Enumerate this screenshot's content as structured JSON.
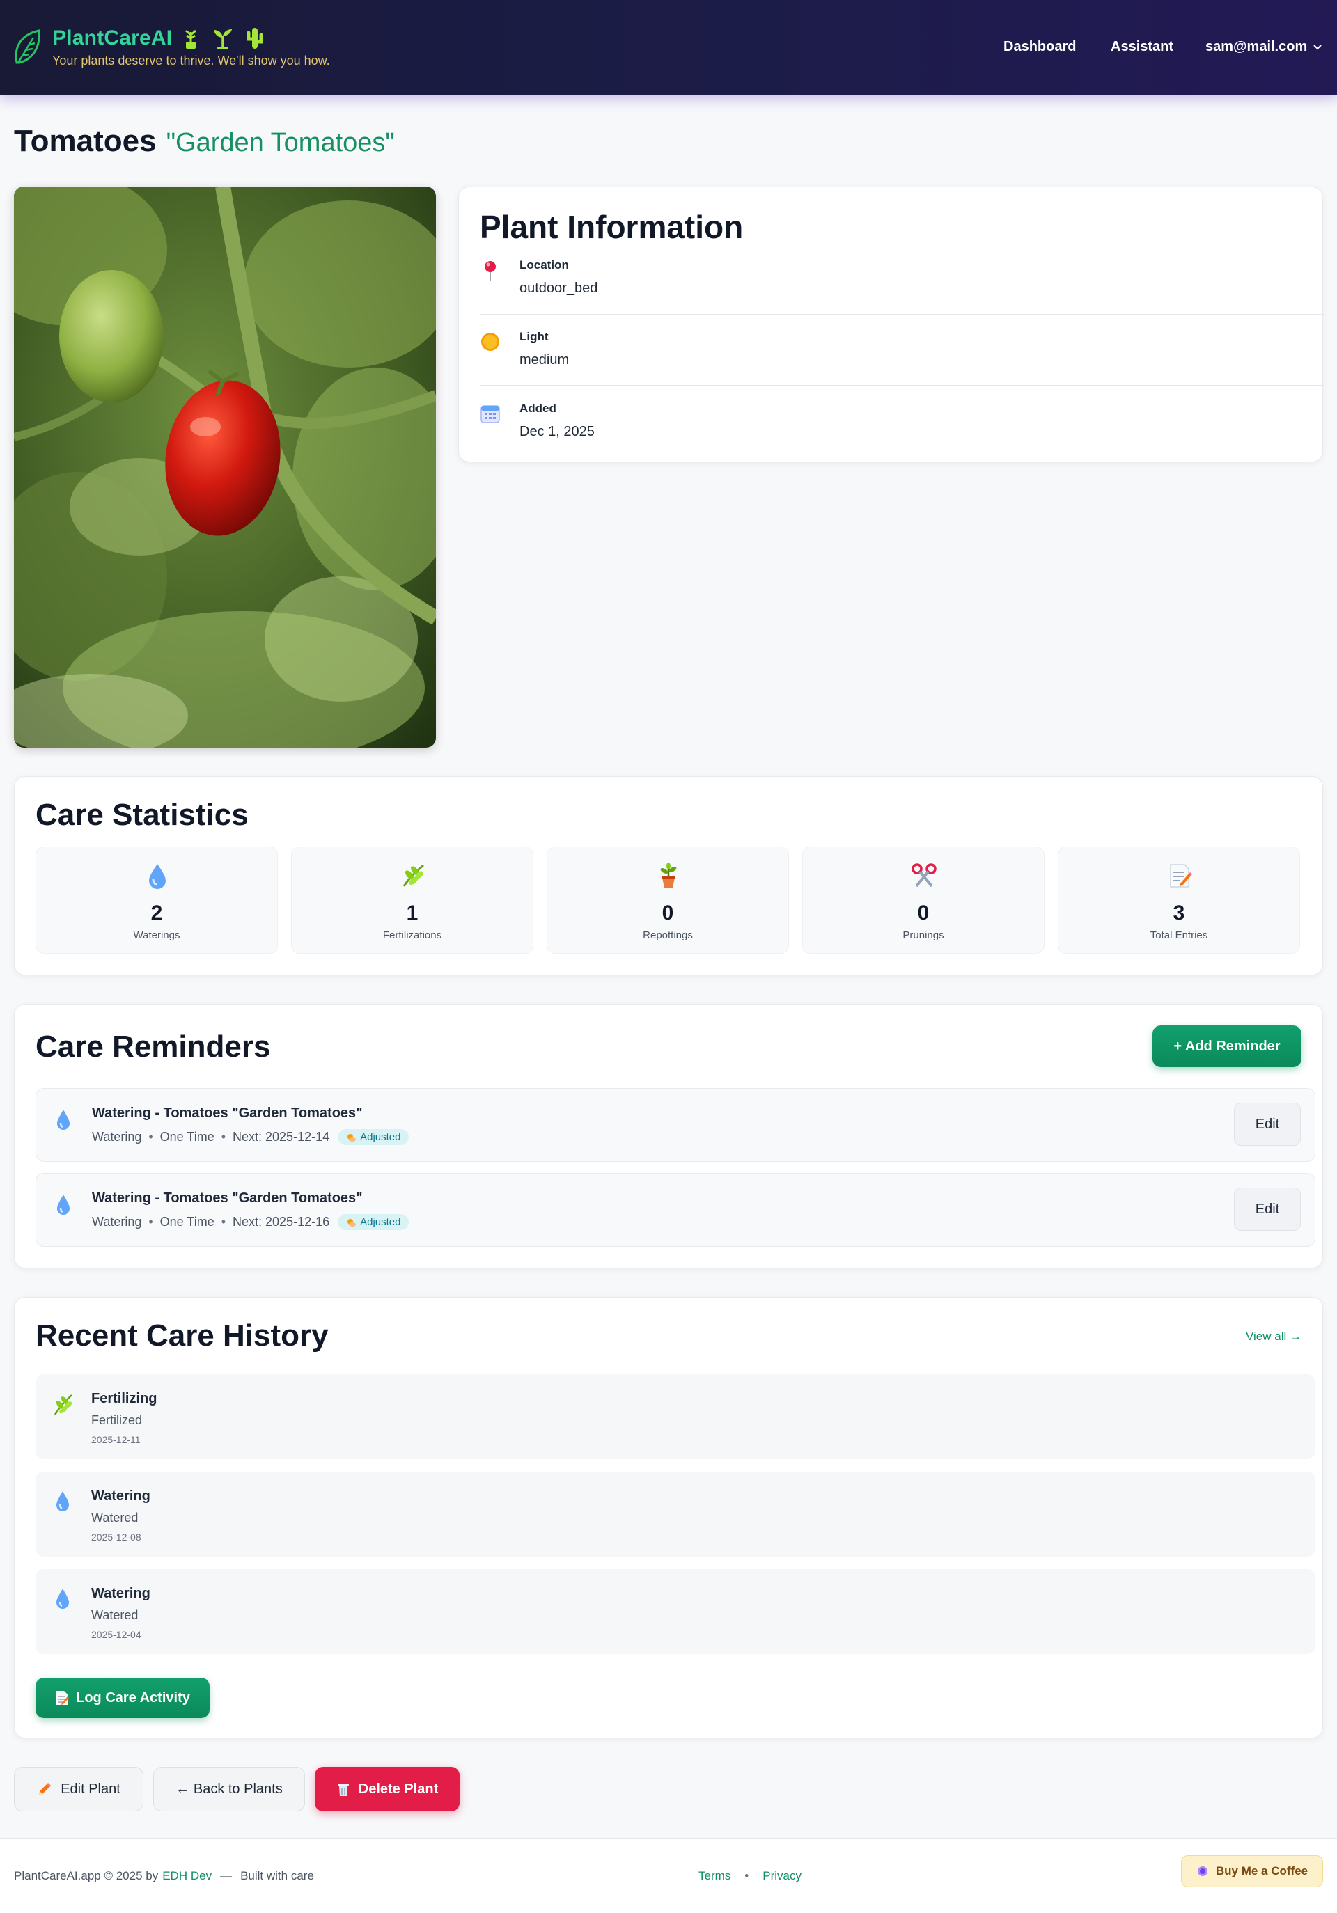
{
  "nav": {
    "brand": "PlantCareAI",
    "tagline": "Your plants deserve to thrive. We'll show you how.",
    "links": {
      "dashboard": "Dashboard",
      "assistant": "Assistant"
    },
    "user_email": "sam@mail.com",
    "brand_icons": [
      "leaf-icon",
      "potted-sprout-icon",
      "seedling-icon",
      "cactus-icon"
    ]
  },
  "plant": {
    "name": "Tomatoes",
    "nickname": "\"Garden Tomatoes\""
  },
  "info": {
    "title": "Plant Information",
    "location": {
      "label": "Location",
      "value": "outdoor_bed",
      "icon": "map-pin-icon"
    },
    "light": {
      "label": "Light",
      "value": "medium",
      "icon": "sun-icon"
    },
    "added": {
      "label": "Added",
      "value": "Dec 1, 2025",
      "icon": "calendar-icon"
    }
  },
  "stats": {
    "title": "Care Statistics",
    "items": [
      {
        "value": "2",
        "label": "Waterings",
        "icon": "water-drop-icon"
      },
      {
        "value": "1",
        "label": "Fertilizations",
        "icon": "herb-icon"
      },
      {
        "value": "0",
        "label": "Repottings",
        "icon": "potted-plant-icon"
      },
      {
        "value": "0",
        "label": "Prunings",
        "icon": "scissors-icon"
      },
      {
        "value": "3",
        "label": "Total Entries",
        "icon": "memo-icon"
      }
    ]
  },
  "reminders": {
    "title": "Care Reminders",
    "add_label": "+ Add Reminder",
    "items": [
      {
        "title": "Watering - Tomatoes \"Garden Tomatoes\"",
        "type": "Watering",
        "freq": "One Time",
        "next": "Next: 2025-12-14",
        "badge": "Adjusted",
        "edit": "Edit"
      },
      {
        "title": "Watering - Tomatoes \"Garden Tomatoes\"",
        "type": "Watering",
        "freq": "One Time",
        "next": "Next: 2025-12-16",
        "badge": "Adjusted",
        "edit": "Edit"
      }
    ],
    "separator": "•"
  },
  "history": {
    "title": "Recent Care History",
    "view_all": "View all →",
    "items": [
      {
        "title": "Fertilizing",
        "note": "Fertilized",
        "date": "2025-12-11",
        "icon": "herb-icon"
      },
      {
        "title": "Watering",
        "note": "Watered",
        "date": "2025-12-08",
        "icon": "water-drop-icon"
      },
      {
        "title": "Watering",
        "note": "Watered",
        "date": "2025-12-04",
        "icon": "water-drop-icon"
      }
    ],
    "log_label": "Log Care Activity"
  },
  "actions": {
    "edit": "Edit Plant",
    "back": "← Back to Plants",
    "delete": "Delete Plant"
  },
  "footer": {
    "copyright": "PlantCareAI.app © 2025 by",
    "author": "EDH Dev",
    "dash": "—",
    "built": "Built with care",
    "terms": "Terms",
    "sep": "•",
    "privacy": "Privacy",
    "coffee": "Buy Me a Coffee"
  },
  "colors": {
    "accent": "#0b8a5b",
    "danger": "#e11d48",
    "nav_bg": "#1c1c48",
    "brand": "#34d399"
  }
}
